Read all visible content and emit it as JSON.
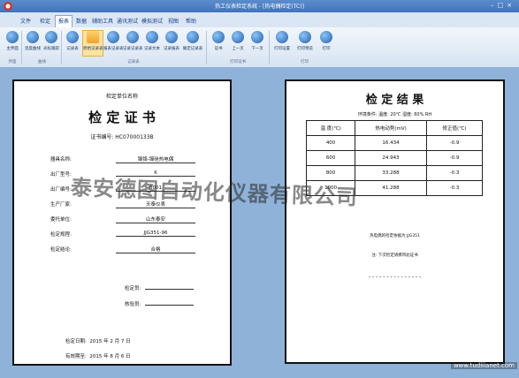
{
  "window": {
    "title": "热工仪表检定系统 - [热电偶检定(TC)]"
  },
  "menu": {
    "tabs": [
      "文件",
      "检定",
      "报表",
      "数据",
      "辅助工具",
      "通讯测试",
      "模拟测试",
      "视图",
      "帮助"
    ],
    "active_index": 2
  },
  "ribbon": {
    "buttons": [
      "主界面",
      "温度曲线",
      "光标跟踪",
      "记录表",
      "原始记录表",
      "报表记录表",
      "记录记录表",
      "记录文本",
      "记录报表",
      "确定记录表",
      "证书",
      "上一页",
      "下一页",
      "打印设置",
      "打印预览",
      "打印"
    ],
    "selected_index": 4,
    "groups": [
      "界面",
      "曲线",
      "记录表",
      "打印证书",
      "打印"
    ]
  },
  "certificate": {
    "org": "检定单位名称",
    "title": "检 定 证 书",
    "number_label": "证书编号:",
    "number": "HC07000133B",
    "fields": [
      {
        "label": "器具名称:",
        "value": "镍铬-镍硅热电偶"
      },
      {
        "label": "出厂型号:",
        "value": "K"
      },
      {
        "label": "出厂编号:",
        "value": "0001"
      },
      {
        "label": "生产厂家:",
        "value": "天泰仪表"
      },
      {
        "label": "委托单位:",
        "value": "山东泰安"
      },
      {
        "label": "检定规程:",
        "value": "JJG351-96"
      },
      {
        "label": "检定结论:",
        "value": "合格"
      }
    ],
    "inspector_label": "检定员:",
    "checker_label": "核验员:",
    "date_label": "检定日期:",
    "date_value": "2015 年  2 月  7 日",
    "valid_label": "有效期至:",
    "valid_value": "2015 年  8 月  6 日"
  },
  "results": {
    "title": "检 定 结 果",
    "env": "环境条件:  温度: 20℃    湿度: 60% RH",
    "headers": [
      "温 度(℃)",
      "热电动势(mV)",
      "修正值(℃)"
    ],
    "rows": [
      [
        "400",
        "16.434",
        "-0.9"
      ],
      [
        "600",
        "24.943",
        "-0.9"
      ],
      [
        "800",
        "33.288",
        "-0.3"
      ],
      [
        "1000",
        "41.288",
        "-0.3"
      ]
    ],
    "note1": "热电偶的检定依据为 JJG351",
    "note2": "注: 下次检定请携带此证书",
    "dashes": "- - - - - - - - - - - - - - -"
  },
  "watermark": "泰安德图自动化仪器有限公司",
  "url": "www.tudiiianet.com"
}
